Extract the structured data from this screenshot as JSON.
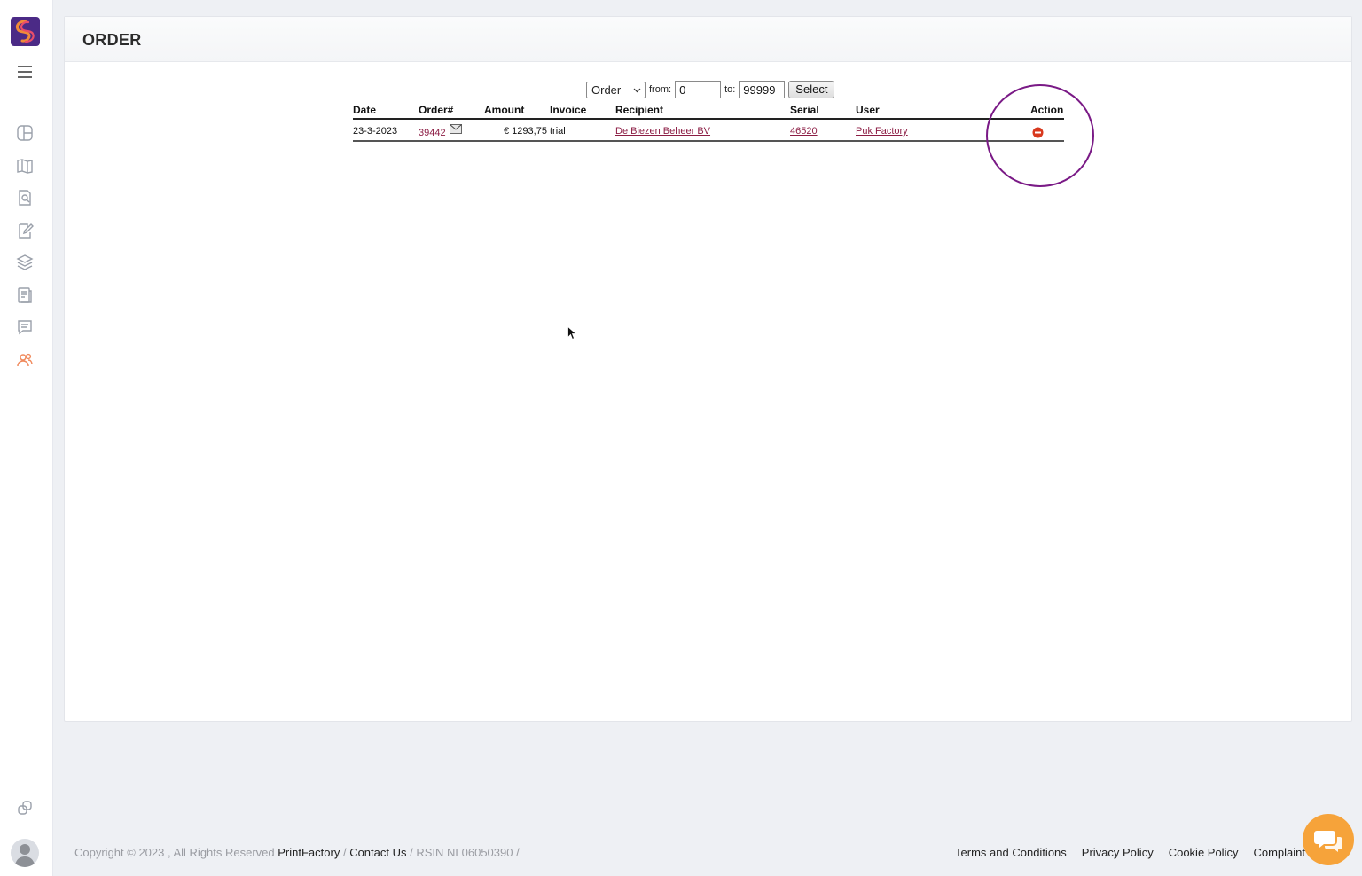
{
  "page": {
    "title": "ORDER"
  },
  "filter": {
    "type_selected": "Order",
    "from_label": "from:",
    "from_value": "0",
    "to_label": "to:",
    "to_value": "99999",
    "select_button": "Select"
  },
  "table": {
    "headers": {
      "date": "Date",
      "order": "Order#",
      "amount": "Amount",
      "invoice": "Invoice",
      "recipient": "Recipient",
      "serial": "Serial",
      "user": "User",
      "action": "Action"
    },
    "rows": [
      {
        "date": "23-3-2023",
        "order": "39442",
        "amount": "€ 1293,75",
        "invoice": "trial",
        "recipient": "De Biezen Beheer BV",
        "serial": "46520",
        "user": "Puk Factory",
        "action_icon": "remove-circle-icon"
      }
    ]
  },
  "footer": {
    "copyright": "Copyright © 2023 , All Rights Reserved",
    "brand": "PrintFactory",
    "sep1": " / ",
    "contact": "Contact Us",
    "rsin": " / RSIN NL06050390 /",
    "links": [
      "Terms and Conditions",
      "Privacy Policy",
      "Cookie Policy",
      "Complaint"
    ]
  },
  "colors": {
    "link": "#8c1d44",
    "brand_purple": "#4b2a86",
    "annotation": "#7a1a86",
    "chat": "#f6a33a",
    "active_nav": "#f08a5d"
  }
}
